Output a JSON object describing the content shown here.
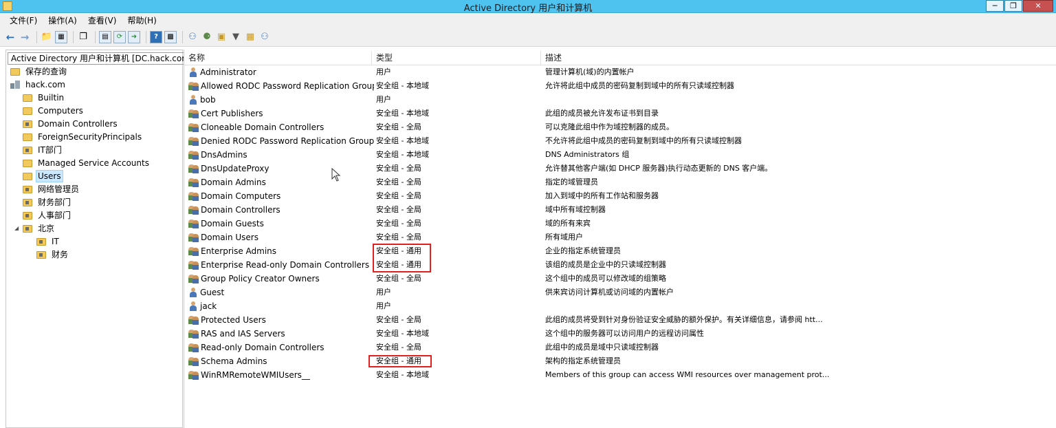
{
  "window": {
    "title": "Active Directory 用户和计算机",
    "minimize_icon": "minimize-icon",
    "restore_icon": "restore-icon",
    "close_icon": "close-icon"
  },
  "menu": [
    {
      "label": "文件(F)"
    },
    {
      "label": "操作(A)"
    },
    {
      "label": "查看(V)"
    },
    {
      "label": "帮助(H)"
    }
  ],
  "tree": {
    "root": "Active Directory 用户和计算机 [DC.hack.com]",
    "saved_queries": "保存的查询",
    "domain": "hack.com",
    "items": [
      {
        "label": "Builtin",
        "ou": false
      },
      {
        "label": "Computers",
        "ou": false
      },
      {
        "label": "Domain Controllers",
        "ou": true
      },
      {
        "label": "ForeignSecurityPrincipals",
        "ou": false
      },
      {
        "label": "IT部门",
        "ou": true
      },
      {
        "label": "Managed Service Accounts",
        "ou": false
      },
      {
        "label": "Users",
        "ou": false,
        "selected": true
      },
      {
        "label": "网络管理员",
        "ou": true
      },
      {
        "label": "财务部门",
        "ou": true
      },
      {
        "label": "人事部门",
        "ou": true
      },
      {
        "label": "北京",
        "ou": true,
        "expanded": true
      }
    ],
    "beijing_children": [
      {
        "label": "IT"
      },
      {
        "label": "财务"
      }
    ]
  },
  "list": {
    "headers": {
      "name": "名称",
      "type": "类型",
      "desc": "描述"
    },
    "rows": [
      {
        "name": "Administrator",
        "icon": "user",
        "type": "用户",
        "desc": "管理计算机(域)的内置帐户"
      },
      {
        "name": "Allowed RODC Password Replication Group",
        "icon": "group",
        "type": "安全组 - 本地域",
        "desc": "允许将此组中成员的密码复制到域中的所有只读域控制器"
      },
      {
        "name": "bob",
        "icon": "user",
        "type": "用户",
        "desc": ""
      },
      {
        "name": "Cert Publishers",
        "icon": "group",
        "type": "安全组 - 本地域",
        "desc": "此组的成员被允许发布证书到目录"
      },
      {
        "name": "Cloneable Domain Controllers",
        "icon": "group",
        "type": "安全组 - 全局",
        "desc": "可以克隆此组中作为域控制器的成员。"
      },
      {
        "name": "Denied RODC Password Replication Group",
        "icon": "group",
        "type": "安全组 - 本地域",
        "desc": "不允许将此组中成员的密码复制到域中的所有只读域控制器"
      },
      {
        "name": "DnsAdmins",
        "icon": "group",
        "type": "安全组 - 本地域",
        "desc": "DNS Administrators 组"
      },
      {
        "name": "DnsUpdateProxy",
        "icon": "group",
        "type": "安全组 - 全局",
        "desc": "允许替其他客户端(如 DHCP 服务器)执行动态更新的 DNS 客户端。"
      },
      {
        "name": "Domain Admins",
        "icon": "group",
        "type": "安全组 - 全局",
        "desc": "指定的域管理员"
      },
      {
        "name": "Domain Computers",
        "icon": "group",
        "type": "安全组 - 全局",
        "desc": "加入到域中的所有工作站和服务器"
      },
      {
        "name": "Domain Controllers",
        "icon": "group",
        "type": "安全组 - 全局",
        "desc": "域中所有域控制器"
      },
      {
        "name": "Domain Guests",
        "icon": "group",
        "type": "安全组 - 全局",
        "desc": "域的所有来宾"
      },
      {
        "name": "Domain Users",
        "icon": "group",
        "type": "安全组 - 全局",
        "desc": "所有域用户"
      },
      {
        "name": "Enterprise Admins",
        "icon": "group",
        "type": "安全组 - 通用",
        "desc": "企业的指定系统管理员"
      },
      {
        "name": "Enterprise Read-only Domain Controllers",
        "icon": "group",
        "type": "安全组 - 通用",
        "desc": "该组的成员是企业中的只读域控制器"
      },
      {
        "name": "Group Policy Creator Owners",
        "icon": "group",
        "type": "安全组 - 全局",
        "desc": "这个组中的成员可以修改域的组策略"
      },
      {
        "name": "Guest",
        "icon": "user",
        "type": "用户",
        "desc": "供来宾访问计算机或访问域的内置帐户"
      },
      {
        "name": "jack",
        "icon": "user",
        "type": "用户",
        "desc": ""
      },
      {
        "name": "Protected Users",
        "icon": "group",
        "type": "安全组 - 全局",
        "desc": "此组的成员将受到针对身份验证安全威胁的额外保护。有关详细信息，请参阅 htt..."
      },
      {
        "name": "RAS and IAS Servers",
        "icon": "group",
        "type": "安全组 - 本地域",
        "desc": "这个组中的服务器可以访问用户的远程访问属性"
      },
      {
        "name": "Read-only Domain Controllers",
        "icon": "group",
        "type": "安全组 - 全局",
        "desc": "此组中的成员是域中只读域控制器"
      },
      {
        "name": "Schema Admins",
        "icon": "group",
        "type": "安全组 - 通用",
        "desc": "架构的指定系统管理员"
      },
      {
        "name": "WinRMRemoteWMIUsers__",
        "icon": "group",
        "type": "安全组 - 本地域",
        "desc": "Members of this group can access WMI resources over management prot..."
      }
    ]
  },
  "highlight_color": "#e02020",
  "selection_color": "#cce8ff"
}
